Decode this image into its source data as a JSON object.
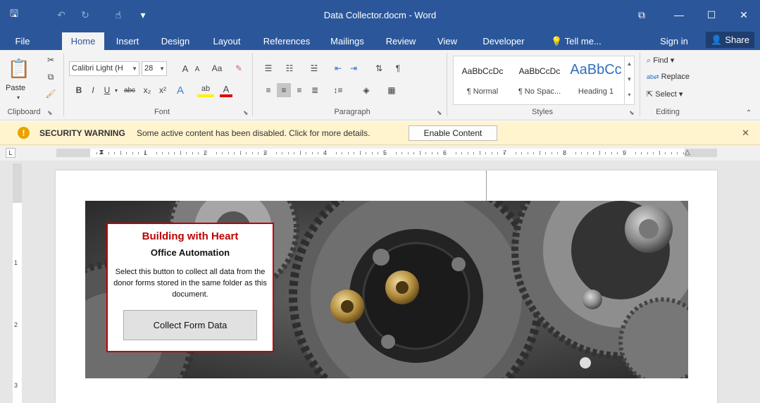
{
  "titlebar": {
    "title": "Data Collector.docm - Word",
    "qat": [
      {
        "icon": "save-icon",
        "glyph": "🖫"
      },
      {
        "icon": "undo-icon",
        "glyph": "↶"
      },
      {
        "icon": "redo-icon",
        "glyph": "↻"
      },
      {
        "icon": "touch-mode-icon",
        "glyph": "☝"
      },
      {
        "icon": "customize-qat-icon",
        "glyph": "▾"
      }
    ],
    "controls": {
      "ribbon_display": "⧉",
      "minimize": "—",
      "maximize": "☐",
      "close": "✕"
    }
  },
  "tabs": [
    {
      "label": "File"
    },
    {
      "label": "Home",
      "active": true
    },
    {
      "label": "Insert"
    },
    {
      "label": "Design"
    },
    {
      "label": "Layout"
    },
    {
      "label": "References"
    },
    {
      "label": "Mailings"
    },
    {
      "label": "Review"
    },
    {
      "label": "View"
    },
    {
      "label": "Developer"
    },
    {
      "label": "Tell me..."
    }
  ],
  "account": {
    "signin": "Sign in",
    "share": "Share"
  },
  "ribbon": {
    "clipboard": {
      "paste": "Paste",
      "label": "Clipboard"
    },
    "font": {
      "family": "Calibri Light (H",
      "size": "28",
      "grow": "A",
      "shrink": "A",
      "case": "Aa",
      "bold": "B",
      "italic": "I",
      "underline": "U",
      "strike": "abc",
      "subscript": "x₂",
      "superscript": "x²",
      "text_effects": "A",
      "highlight": "ab",
      "font_color": "A",
      "label": "Font"
    },
    "paragraph": {
      "label": "Paragraph"
    },
    "styles": {
      "items": [
        {
          "sample": "AaBbCcDc",
          "name": "¶ Normal"
        },
        {
          "sample": "AaBbCcDc",
          "name": "¶ No Spac..."
        },
        {
          "sample": "AaBbCc",
          "name": "Heading 1"
        }
      ],
      "label": "Styles"
    },
    "editing": {
      "find": "Find",
      "replace": "Replace",
      "select": "Select",
      "label": "Editing"
    }
  },
  "security": {
    "title": "SECURITY WARNING",
    "message": "Some active content has been disabled. Click for more details.",
    "button": "Enable Content"
  },
  "ruler": {
    "tab_selector": "L",
    "numbers": [
      "1",
      "2",
      "3",
      "4",
      "5",
      "6",
      "7",
      "8",
      "9"
    ],
    "vnumbers": [
      "1",
      "2",
      "3"
    ]
  },
  "card": {
    "title": "Building with Heart",
    "subtitle": "Office Automation",
    "description": "Select this button to collect all data from the donor forms stored in the same folder as this document.",
    "button": "Collect Form Data"
  },
  "colors": {
    "title_bar": "#2b579a",
    "security_bar": "#fff4ce",
    "card_accent": "#c00000"
  }
}
